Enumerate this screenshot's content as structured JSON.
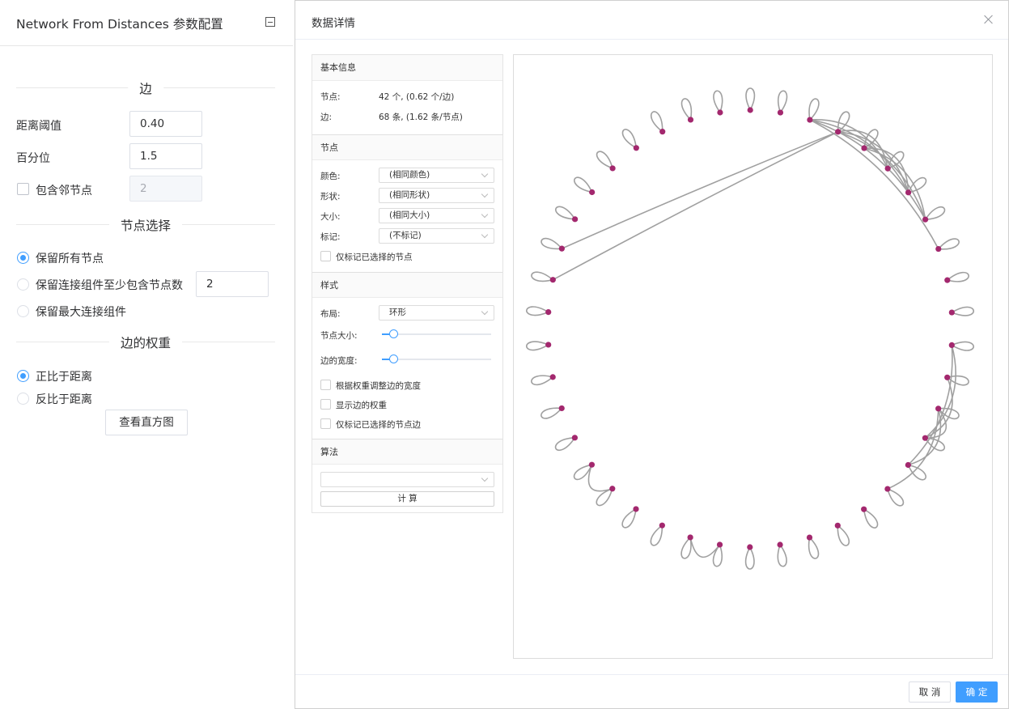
{
  "left_panel": {
    "title": "Network From Distances 参数配置",
    "sections": {
      "edges": "边",
      "node_selection": "节点选择",
      "edge_weights": "边的权重"
    },
    "distance_threshold": {
      "label": "距离阈值",
      "value": "0.40"
    },
    "percentile": {
      "label": "百分位",
      "value": "1.5"
    },
    "include_neighbors": {
      "label": "包含邻节点",
      "checked": false,
      "value": "2"
    },
    "node_options": [
      {
        "label": "保留所有节点",
        "selected": true
      },
      {
        "label": "保留连接组件至少包含节点数",
        "selected": false,
        "value": "2"
      },
      {
        "label": "保留最大连接组件",
        "selected": false
      }
    ],
    "weight_options": [
      {
        "label": "正比于距离",
        "selected": true
      },
      {
        "label": "反比于距离",
        "selected": false
      }
    ],
    "histogram_button": "查看直方图"
  },
  "dialog": {
    "title": "数据详情",
    "info": {
      "head": "基本信息",
      "nodes_label": "节点:",
      "nodes_value": "42 个,  (0.62 个/边)",
      "edges_label": "边:",
      "edges_value": "68 条,  (1.62 条/节点)"
    },
    "nodes": {
      "head": "节点",
      "color": {
        "label": "颜色:",
        "value": "(相同颜色)"
      },
      "shape": {
        "label": "形状:",
        "value": "(相同形状)"
      },
      "size": {
        "label": "大小:",
        "value": "(相同大小)"
      },
      "mark": {
        "label": "标记:",
        "value": "(不标记)"
      },
      "only_selected": "仅标记已选择的节点"
    },
    "style": {
      "head": "样式",
      "layout": {
        "label": "布局:",
        "value": "环形"
      },
      "node_size_label": "节点大小:",
      "node_size_level": 0.1,
      "edge_width_label": "边的宽度:",
      "edge_width_level": 0.1,
      "adjust_by_weight": "根据权重调整边的宽度",
      "show_weight": "显示边的权重",
      "only_selected_edges": "仅标记已选择的节点边"
    },
    "algorithm": {
      "head": "算法",
      "select_value": "",
      "compute_button": "计 算"
    },
    "graph": {
      "node_count": 42,
      "layout": "circular",
      "node_color": "#a3286e",
      "edge_color": "#a0a0a0",
      "links": [
        [
          0,
          3
        ],
        [
          0,
          4
        ],
        [
          0,
          5
        ],
        [
          0,
          6
        ],
        [
          1,
          3
        ],
        [
          1,
          4
        ],
        [
          1,
          5
        ],
        [
          2,
          4
        ],
        [
          2,
          5
        ],
        [
          1,
          31
        ],
        [
          1,
          32
        ],
        [
          20,
          21
        ],
        [
          24,
          25
        ],
        [
          11,
          12
        ],
        [
          11,
          13
        ],
        [
          10,
          12
        ],
        [
          11,
          14
        ],
        [
          9,
          12
        ],
        [
          9,
          13
        ]
      ]
    },
    "footer": {
      "cancel": "取 消",
      "ok": "确 定"
    },
    "colors": {
      "accent": "#409eff",
      "node": "#a3286e",
      "edge": "#a0a0a0"
    }
  }
}
